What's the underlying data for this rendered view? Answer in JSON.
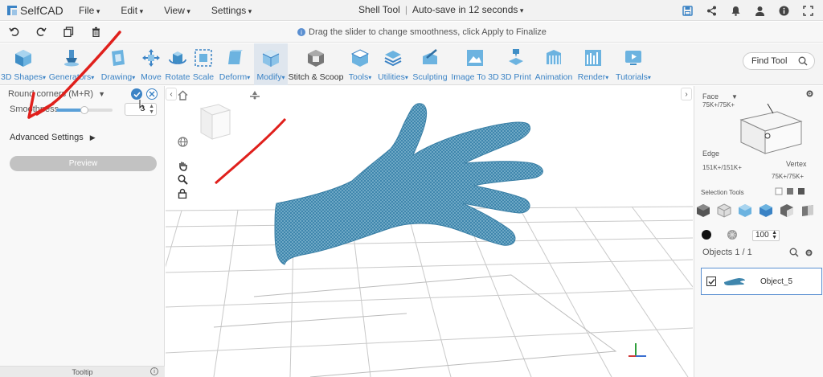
{
  "app": {
    "name": "SelfCAD"
  },
  "menu": [
    {
      "id": "file",
      "label": "File"
    },
    {
      "id": "edit",
      "label": "Edit"
    },
    {
      "id": "view",
      "label": "View"
    },
    {
      "id": "settings",
      "label": "Settings"
    }
  ],
  "title": {
    "tool": "Shell Tool",
    "separator": "|",
    "autosave": "Auto-save in 12 seconds"
  },
  "hint": "Drag the slider to change smoothness, click Apply to Finalize",
  "toolbar": [
    {
      "id": "3d-shapes",
      "label": "3D Shapes",
      "dropdown": true
    },
    {
      "id": "generators",
      "label": "Generators",
      "dropdown": true
    },
    {
      "id": "drawing",
      "label": "Drawing",
      "dropdown": true
    },
    {
      "id": "move",
      "label": "Move",
      "dropdown": false
    },
    {
      "id": "rotate",
      "label": "Rotate",
      "dropdown": false
    },
    {
      "id": "scale",
      "label": "Scale",
      "dropdown": false
    },
    {
      "id": "deform",
      "label": "Deform",
      "dropdown": true
    },
    {
      "id": "modify",
      "label": "Modify",
      "dropdown": true
    },
    {
      "id": "stitch-scoop",
      "label": "Stitch & Scoop",
      "dropdown": false
    },
    {
      "id": "tools",
      "label": "Tools",
      "dropdown": true
    },
    {
      "id": "utilities",
      "label": "Utilities",
      "dropdown": true
    },
    {
      "id": "sculpting",
      "label": "Sculpting",
      "dropdown": false
    },
    {
      "id": "image-to-3d",
      "label": "Image To 3D",
      "dropdown": false
    },
    {
      "id": "3d-print",
      "label": "3D Print",
      "dropdown": false
    },
    {
      "id": "animation",
      "label": "Animation",
      "dropdown": false
    },
    {
      "id": "render",
      "label": "Render",
      "dropdown": true
    },
    {
      "id": "tutorials",
      "label": "Tutorials",
      "dropdown": true
    }
  ],
  "find_tool": {
    "label": "Find Tool"
  },
  "left_panel": {
    "title": "Round corners (M+R)",
    "smoothness_label": "Smoothness",
    "smoothness_value": "3",
    "smoothness_fraction": 0.5,
    "advanced_label": "Advanced Settings",
    "preview_label": "Preview",
    "tooltip_label": "Tooltip"
  },
  "right_panel": {
    "face_label": "Face",
    "face_count": "75K+/75K+",
    "edge_label": "Edge",
    "edge_count": "151K+/151K+",
    "vertex_label": "Vertex",
    "vertex_count": "75K+/75K+",
    "selection_tools_label": "Selection Tools",
    "size_value": "100",
    "objects_label": "Objects 1 / 1",
    "object_name": "Object_5"
  },
  "colors": {
    "accent": "#3b83c5",
    "mesh": "#4a8db0",
    "annotation_arrow": "#e0201c"
  }
}
